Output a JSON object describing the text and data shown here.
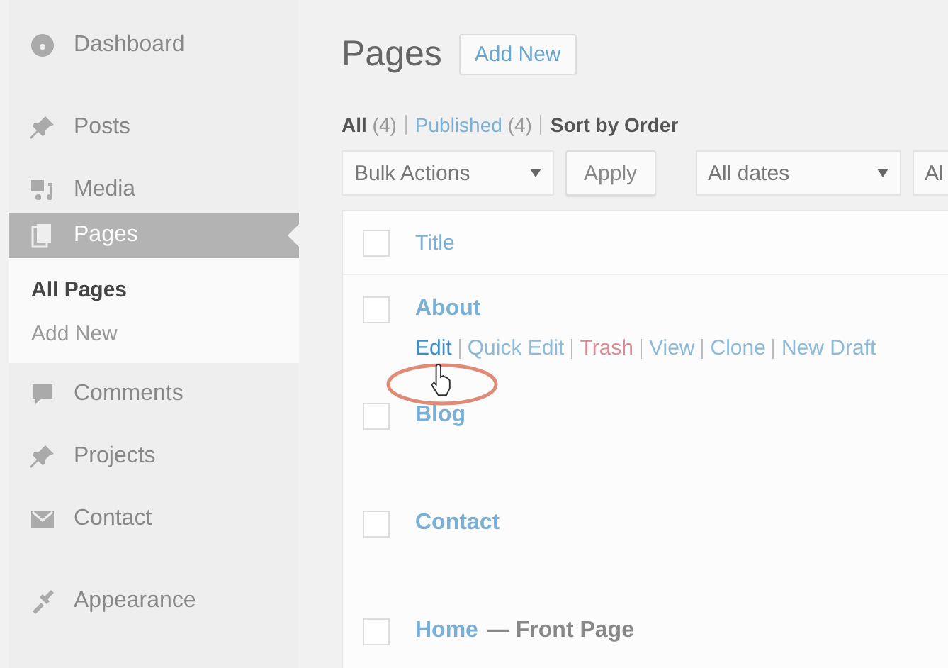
{
  "sidebar": {
    "items": [
      {
        "label": "Dashboard",
        "selected": false
      },
      {
        "label": "Posts",
        "selected": false
      },
      {
        "label": "Media",
        "selected": false
      },
      {
        "label": "Pages",
        "selected": true,
        "children": [
          {
            "label": "All Pages",
            "selected": true
          },
          {
            "label": "Add New",
            "selected": false
          }
        ]
      },
      {
        "label": "Comments",
        "selected": false
      },
      {
        "label": "Projects",
        "selected": false
      },
      {
        "label": "Contact",
        "selected": false
      },
      {
        "label": "Appearance",
        "selected": false
      }
    ]
  },
  "header": {
    "title": "Pages",
    "button": "Add New"
  },
  "views": [
    {
      "label": "All",
      "count": "(4)",
      "selected": true
    },
    {
      "label": "Published",
      "count": "(4)",
      "selected": false
    }
  ],
  "sort_link": "Sort by Order",
  "toolbar": {
    "bulk": "Bulk Actions",
    "apply": "Apply",
    "dates": "All dates",
    "column_4": "Al"
  },
  "table": {
    "column": "Title",
    "header_checked": false,
    "rows": [
      {
        "title": "About",
        "checked": false,
        "actions": [
          {
            "label": "Edit",
            "kind": "link",
            "hovered": true
          },
          {
            "label": "Quick Edit",
            "kind": "link",
            "hovered": false
          },
          {
            "label": "Trash",
            "kind": "delete",
            "hovered": false
          },
          {
            "label": "View",
            "kind": "link",
            "hovered": false
          },
          {
            "label": "Clone",
            "kind": "link",
            "hovered": false
          },
          {
            "label": "New Draft",
            "kind": "link",
            "hovered": false
          }
        ]
      },
      {
        "title": "Blog",
        "checked": false
      },
      {
        "title": "Contact",
        "checked": false
      },
      {
        "title": "Home",
        "state": "— Front Page",
        "checked": false
      }
    ]
  }
}
